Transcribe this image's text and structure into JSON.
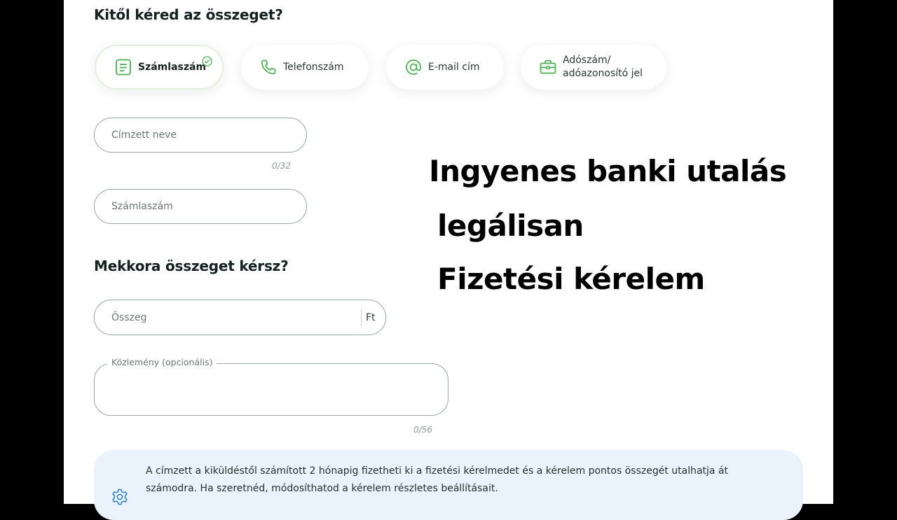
{
  "recipient_section": {
    "heading": "Kitől kéred az összeget?",
    "options": [
      {
        "label": "Számlaszám",
        "icon": "document-icon",
        "selected": true
      },
      {
        "label": "Telefonszám",
        "icon": "phone-icon",
        "selected": false
      },
      {
        "label": "E-mail cím",
        "icon": "at-sign-icon",
        "selected": false
      },
      {
        "label": "Adószám/ adóazonosító jel",
        "icon": "briefcase-icon",
        "selected": false
      }
    ],
    "name_placeholder": "Címzett neve",
    "name_counter": "0/32",
    "account_placeholder": "Számlaszám"
  },
  "amount_section": {
    "heading": "Mekkora összeget kérsz?",
    "amount_placeholder": "Összeg",
    "currency": "Ft",
    "comment_label": "Közlemény (opcionális)",
    "comment_counter": "0/56"
  },
  "overlay_text": {
    "line1": "Ingyenes banki utalás",
    "line2": "legálisan",
    "line3": "Fizetési kérelem"
  },
  "info_box": {
    "text": "A címzett a kiküldéstől számított 2 hónapig fizetheti ki a fizetési kérelmedet és a kérelem pontos összegét utalhatja át számodra. Ha szeretnéd, módosíthatod a kérelem részletes beállításait.",
    "icon": "settings-icon"
  },
  "colors": {
    "accent_green": "#4caf50",
    "info_bg": "#eaf3fb",
    "icon_blue": "#2f7fc1"
  }
}
